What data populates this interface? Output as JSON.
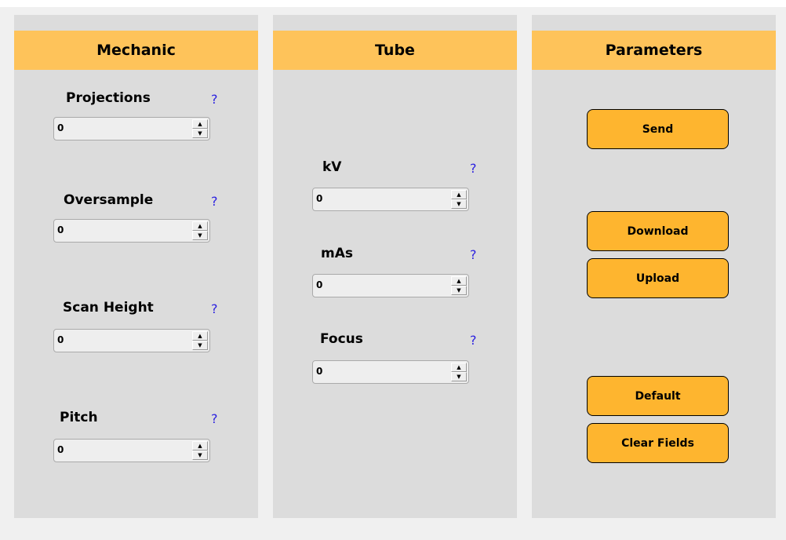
{
  "panels": {
    "mechanic": {
      "title": "Mechanic",
      "fields": [
        {
          "label": "Projections",
          "value": "0",
          "help": "?"
        },
        {
          "label": "Oversample",
          "value": "0",
          "help": "?"
        },
        {
          "label": "Scan Height",
          "value": "0",
          "help": "?"
        },
        {
          "label": "Pitch",
          "value": "0",
          "help": "?"
        }
      ]
    },
    "tube": {
      "title": "Tube",
      "fields": [
        {
          "label": "kV",
          "value": "0",
          "help": "?"
        },
        {
          "label": "mAs",
          "value": "0",
          "help": "?"
        },
        {
          "label": "Focus",
          "value": "0",
          "help": "?"
        }
      ]
    },
    "parameters": {
      "title": "Parameters",
      "buttons": {
        "send": "Send",
        "download": "Download",
        "upload": "Upload",
        "default": "Default",
        "clear": "Clear Fields"
      }
    }
  },
  "icons": {
    "up": "▲",
    "down": "▼"
  },
  "colors": {
    "header": "#fec35a",
    "button": "#feb52f",
    "help": "#2a1fe0"
  }
}
